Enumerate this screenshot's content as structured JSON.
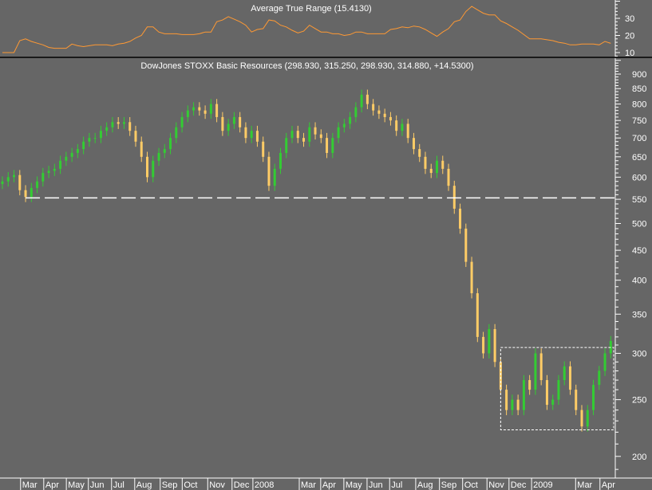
{
  "chart_data": [
    {
      "type": "line",
      "title": "Average True Range (15.4130)",
      "y_ticks": [
        10,
        20,
        30
      ],
      "ylim": [
        7,
        43
      ],
      "color": "#ff9933",
      "values": [
        10,
        10,
        10,
        17,
        18,
        16.5,
        15.5,
        14.5,
        13,
        12.5,
        12.5,
        12.5,
        15,
        14,
        13.5,
        14,
        14.5,
        14.5,
        14.5,
        14,
        15,
        15.5,
        16.5,
        18.5,
        20,
        25,
        25,
        22,
        21,
        21,
        21,
        20.5,
        20.5,
        20.5,
        21,
        22,
        22,
        28,
        29,
        31,
        29.5,
        28,
        26,
        22,
        23.5,
        24,
        29,
        28.5,
        26,
        25,
        23,
        21.5,
        22.5,
        26,
        24,
        22,
        22,
        21,
        21,
        20,
        20.5,
        22,
        22,
        21,
        21,
        21,
        21,
        23.5,
        24,
        25,
        24.5,
        25.5,
        25,
        23.5,
        21.5,
        19.5,
        22,
        24,
        28,
        29,
        34,
        37,
        35,
        33,
        32,
        32,
        28.5,
        27,
        25,
        23,
        20.5,
        18,
        18,
        18,
        17.5,
        17,
        16,
        15.5,
        14.5,
        14.5,
        15,
        15,
        15,
        14.5,
        16.5,
        15.4
      ]
    },
    {
      "type": "candlestick",
      "title": "DowJones STOXX Basic Resources (298.930, 315.250, 298.930, 314.880, +14.5300)",
      "scale": "log",
      "ylim": [
        185,
        900
      ],
      "y_ticks": [
        900,
        850,
        800,
        750,
        700,
        650,
        600,
        550,
        500,
        450,
        400,
        350,
        300,
        250,
        200
      ],
      "up_color": "#33cc33",
      "down_color": "#ffcc66",
      "closes": [
        590,
        600,
        605,
        570,
        555,
        575,
        590,
        610,
        615,
        620,
        640,
        650,
        660,
        670,
        690,
        700,
        700,
        720,
        730,
        745,
        740,
        745,
        720,
        690,
        650,
        600,
        640,
        660,
        670,
        700,
        730,
        760,
        780,
        790,
        780,
        770,
        800,
        760,
        720,
        740,
        760,
        730,
        700,
        720,
        690,
        650,
        580,
        620,
        660,
        700,
        720,
        700,
        690,
        730,
        710,
        700,
        660,
        700,
        730,
        740,
        760,
        790,
        830,
        800,
        780,
        770,
        760,
        750,
        720,
        740,
        700,
        670,
        650,
        620,
        610,
        640,
        620,
        580,
        530,
        490,
        430,
        380,
        320,
        300,
        330,
        290,
        260,
        240,
        250,
        240,
        270,
        260,
        300,
        270,
        245,
        250,
        270,
        285,
        260,
        240,
        225,
        240,
        265,
        280,
        300,
        314.88
      ],
      "support_level": 553,
      "range_box": {
        "from_week": 86,
        "to_week": 105.5,
        "top": 307,
        "bottom": 222
      },
      "x_ticks": [
        {
          "label": "Mar",
          "week": 3
        },
        {
          "label": "Apr",
          "week": 7
        },
        {
          "label": "May",
          "week": 10.9
        },
        {
          "label": "Jun",
          "week": 14.7
        },
        {
          "label": "Jul",
          "week": 18.7
        },
        {
          "label": "Aug",
          "week": 22.7
        },
        {
          "label": "Sep",
          "week": 27.1
        },
        {
          "label": "Oct",
          "week": 30.9
        },
        {
          "label": "Nov",
          "week": 35.3
        },
        {
          "label": "Dec",
          "week": 39.5
        },
        {
          "label": "2008",
          "week": 43.1
        },
        {
          "label": "Mar",
          "week": 51.1
        },
        {
          "label": "Apr",
          "week": 54.8
        },
        {
          "label": "May",
          "week": 58.8
        },
        {
          "label": "Jun",
          "week": 62.8
        },
        {
          "label": "Jul",
          "week": 66.7
        },
        {
          "label": "Aug",
          "week": 71.2
        },
        {
          "label": "Sep",
          "week": 75.3
        },
        {
          "label": "Oct",
          "week": 79.3
        },
        {
          "label": "Nov",
          "week": 83.5
        },
        {
          "label": "Dec",
          "week": 87.3
        },
        {
          "label": "2009",
          "week": 91.2
        },
        {
          "label": "Mar",
          "week": 98.8
        },
        {
          "label": "Apr",
          "week": 103
        }
      ]
    }
  ]
}
